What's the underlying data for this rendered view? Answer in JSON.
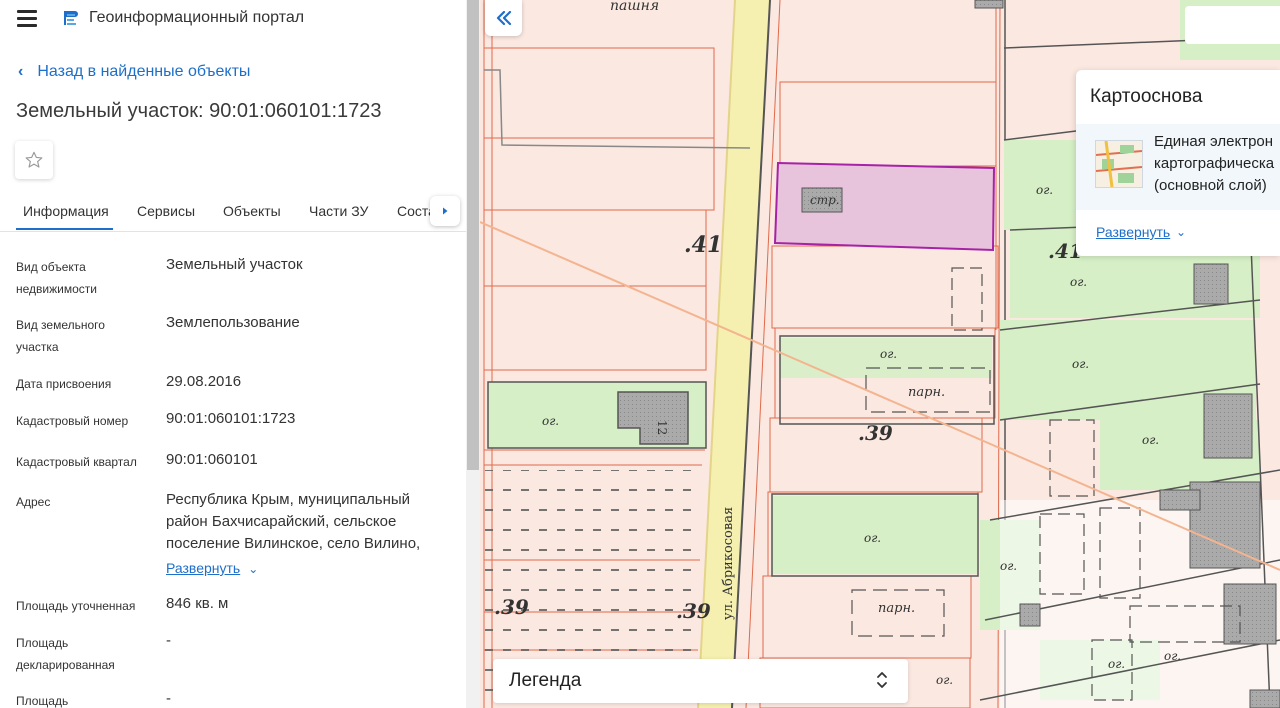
{
  "header": {
    "app_title": "Геоинформационный портал",
    "menu_icon": "menu-icon",
    "logo_icon": "portal-logo-icon"
  },
  "navigation": {
    "back_label": "Назад в найденные объекты"
  },
  "object": {
    "title": "Земельный участок: 90:01:060101:1723"
  },
  "tabs": [
    {
      "label": "Информация",
      "active": true
    },
    {
      "label": "Сервисы"
    },
    {
      "label": "Объекты"
    },
    {
      "label": "Части ЗУ"
    },
    {
      "label": "Соста"
    }
  ],
  "info_rows": [
    {
      "label": "Вид объекта недвижимости",
      "value": "Земельный участок"
    },
    {
      "label": "Вид земельного участка",
      "value": "Землепользование"
    },
    {
      "label": "Дата присвоения",
      "value": "29.08.2016"
    },
    {
      "label": "Кадастровый номер",
      "value": "90:01:060101:1723"
    },
    {
      "label": "Кадастровый квартал",
      "value": "90:01:060101"
    },
    {
      "label": "Адрес",
      "value": "Республика Крым, муниципальный район Бахчисарайский, сельское поселение Вилинское, село Вилино,",
      "expand_label": "Развернуть"
    },
    {
      "label": "Площадь уточненная",
      "value": "846 кв. м"
    },
    {
      "label": "Площадь декларированная",
      "value": "-"
    },
    {
      "label": "Площадь",
      "value": "-"
    }
  ],
  "map": {
    "labels": {
      "pashnya": "пашня",
      "str": "стр.",
      "og": "ог.",
      "park": "парн.",
      "num41": ".41",
      "num39": ".39",
      "street": "ул. Абрикосовая",
      "house": "12"
    },
    "colors": {
      "selected_fill": "#e8c3dc",
      "selected_stroke": "#a622a6",
      "parcel_stroke": "#ec6b4d",
      "garden_fill": "#d7efc9",
      "street_fill": "#f7f2b3",
      "building_fill": "#b3b3b3"
    }
  },
  "basemap": {
    "title": "Картооснова",
    "item_name": "Единая электронная картографическая (основной слой)",
    "item_lines": [
      "Единая электрон",
      "картографическа",
      "(основной слой)"
    ],
    "expand_label": "Развернуть"
  },
  "legend": {
    "label": "Легенда"
  }
}
